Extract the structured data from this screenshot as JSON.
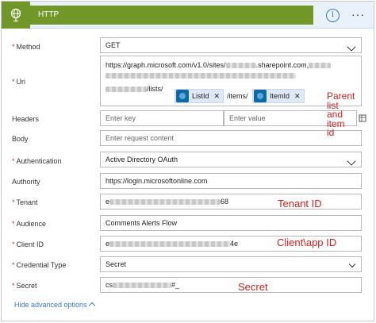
{
  "header": {
    "title": "HTTP",
    "info_glyph": "i",
    "more_glyph": "···"
  },
  "colors": {
    "header_badge": "#709727",
    "annotation": "#d31f1f",
    "link": "#3b78c4"
  },
  "fields": {
    "method": {
      "label": "Method",
      "required": true,
      "value": "GET"
    },
    "uri": {
      "label": "Uri",
      "required": true,
      "line1_prefix": "https://graph.microsoft.com/v1.0/sites/",
      "line1_middle": ".sharepoint.com,",
      "line3_suffix": "/lists/",
      "token_list": "ListId",
      "between": "/items/",
      "token_item": "ItemId"
    },
    "headers": {
      "label": "Headers",
      "required": false,
      "key_placeholder": "Enter key",
      "value_placeholder": "Enter value"
    },
    "body": {
      "label": "Body",
      "required": false,
      "placeholder": "Enter request content"
    },
    "authentication": {
      "label": "Authentication",
      "required": true,
      "value": "Active Directory OAuth"
    },
    "authority": {
      "label": "Authority",
      "required": false,
      "value": "https://login.microsoftonline.com"
    },
    "tenant": {
      "label": "Tenant",
      "required": true,
      "value_prefix": "e",
      "value_suffix": "68"
    },
    "audience": {
      "label": "Audience",
      "required": true,
      "value": "Comments Alerts Flow"
    },
    "client_id": {
      "label": "Client ID",
      "required": true,
      "value_prefix": "e",
      "value_suffix": "4e"
    },
    "credential_type": {
      "label": "Credential Type",
      "required": true,
      "value": "Secret"
    },
    "secret": {
      "label": "Secret",
      "required": true,
      "value_prefix": "cs",
      "value_suffix": "#_"
    }
  },
  "annotations": {
    "parent_list": [
      "Parent",
      "list",
      "and",
      "item",
      "id"
    ],
    "tenant": "Tenant ID",
    "client": "Client\\app ID",
    "secret": "Secret"
  },
  "footer": {
    "link": "Hide advanced options"
  }
}
